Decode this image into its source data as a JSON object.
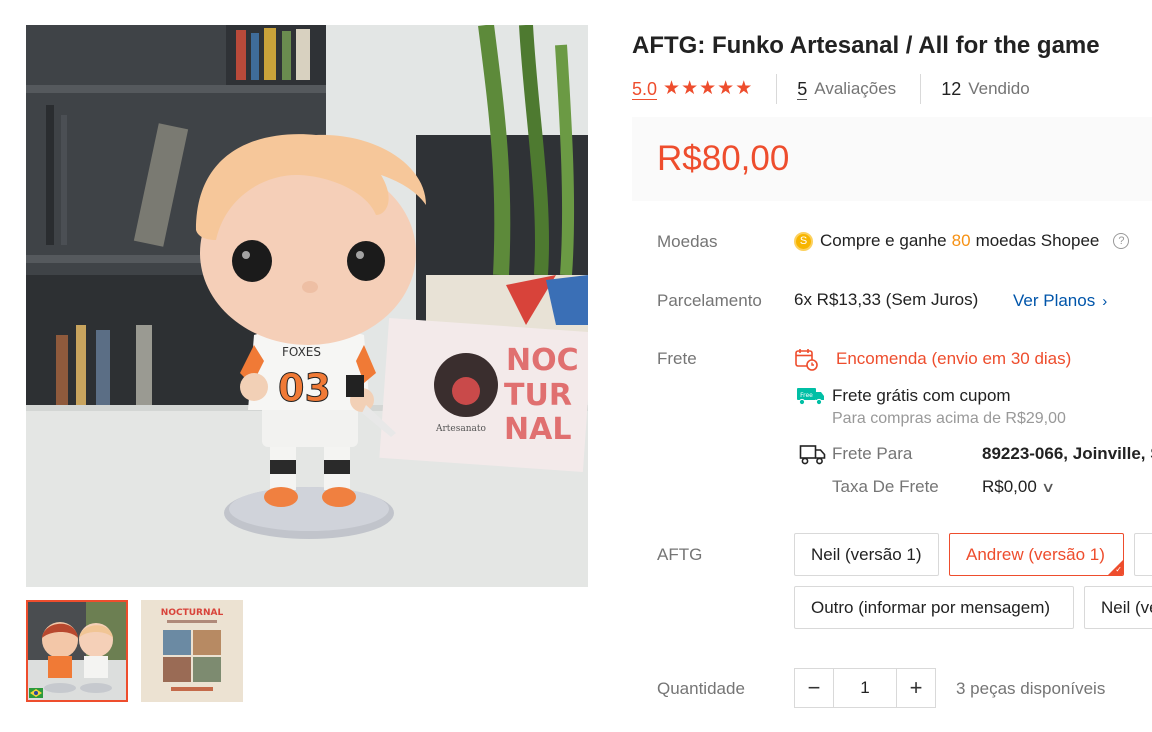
{
  "product": {
    "title": "AFTG: Funko Artesanal / All for the game",
    "rating": "5.0",
    "stars": 5,
    "reviews_count": "5",
    "reviews_label": "Avaliações",
    "sold_count": "12",
    "sold_label": "Vendido",
    "price": "R$80,00"
  },
  "gallery": {
    "main_image": "funko-figure-photo",
    "sign_text": [
      "NOC",
      "TUR",
      "NAL"
    ],
    "sign_sub": "Artesanato",
    "jersey_text": "FOXES",
    "jersey_number": "03",
    "thumbnails": [
      {
        "name": "two-funko-figures-photo",
        "active": true
      },
      {
        "name": "nocturnal-collage-photo",
        "active": false,
        "title": "NOCTURNAL"
      }
    ]
  },
  "coins": {
    "label": "Moedas",
    "prefix": "Compre e ganhe",
    "amount": "80",
    "suffix": "moedas Shopee",
    "help_icon": "question-icon"
  },
  "installments": {
    "label": "Parcelamento",
    "text": "6x R$13,33 (Sem Juros)",
    "link": "Ver Planos",
    "link_icon": "chevron-right-icon"
  },
  "shipping": {
    "label": "Frete",
    "order_text": "Encomenda (envio em 30 dias)",
    "free_title": "Frete grátis com cupom",
    "free_badge": "Free",
    "free_sub": "Para compras acima de R$29,00",
    "to_label": "Frete Para",
    "to_value": "89223-066, Joinville, S",
    "fee_label": "Taxa De Frete",
    "fee_value": "R$0,00"
  },
  "variations": {
    "label": "AFTG",
    "options": [
      {
        "label": "Neil (versão 1)",
        "selected": false
      },
      {
        "label": "Andrew (versão 1)",
        "selected": true
      },
      {
        "label": "",
        "selected": false
      },
      {
        "label": "Outro (informar por mensagem)",
        "selected": false
      },
      {
        "label": "Neil (ve",
        "selected": false
      }
    ]
  },
  "quantity": {
    "label": "Quantidade",
    "value": "1",
    "minus": "−",
    "plus": "+",
    "available": "3 peças disponíveis"
  },
  "colors": {
    "accent": "#ee4d2d",
    "link": "#0055aa",
    "coin": "#f7b500",
    "free_shipping": "#00bfa5",
    "muted": "#757575"
  }
}
